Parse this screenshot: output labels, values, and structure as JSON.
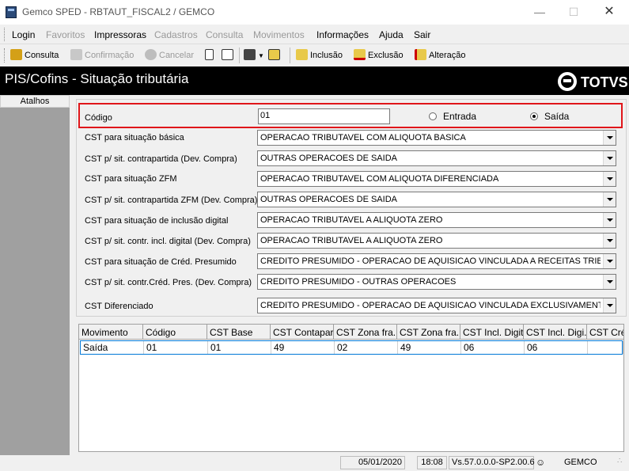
{
  "window": {
    "title": "Gemco SPED - RBTAUT_FISCAL2 / GEMCO",
    "minimize_icon": "minimize-icon",
    "maximize_icon": "maximize-icon",
    "close_icon": "close-icon"
  },
  "menu": {
    "items": [
      {
        "label": "Login",
        "enabled": true
      },
      {
        "label": "Favoritos",
        "enabled": false
      },
      {
        "label": "Impressoras",
        "enabled": true
      },
      {
        "label": "Cadastros",
        "enabled": false
      },
      {
        "label": "Consulta",
        "enabled": false
      },
      {
        "label": "Movimentos",
        "enabled": false
      },
      {
        "label": "Informações",
        "enabled": true
      },
      {
        "label": "Ajuda",
        "enabled": true
      },
      {
        "label": "Sair",
        "enabled": true
      }
    ]
  },
  "toolbar": {
    "consulta": "Consulta",
    "confirmacao": "Confirmação",
    "cancelar": "Cancelar",
    "inclusao": "Inclusão",
    "exclusao": "Exclusão",
    "alteracao": "Alteração"
  },
  "header": {
    "title": "PIS/Cofins - Situação tributária",
    "brand": "TOTVS"
  },
  "sidebar": {
    "title": "Atalhos"
  },
  "form": {
    "codigo_label": "Código",
    "codigo_value": "01",
    "radio_entrada": "Entrada",
    "radio_saida": "Saída",
    "selected_radio": "Saída",
    "fields": [
      {
        "label": "CST para situação básica",
        "value": "OPERACAO TRIBUTAVEL COM ALIQUOTA BASICA"
      },
      {
        "label": "CST p/ sit. contrapartida (Dev. Compra)",
        "value": "OUTRAS OPERACOES DE SAIDA"
      },
      {
        "label": "CST para situação ZFM",
        "value": "OPERACAO TRIBUTAVEL COM ALIQUOTA DIFERENCIADA"
      },
      {
        "label": "CST p/ sit. contrapartida ZFM (Dev. Compra)",
        "value": "OUTRAS OPERACOES DE SAIDA"
      },
      {
        "label": "CST para situação de inclusão digital",
        "value": "OPERACAO TRIBUTAVEL A ALIQUOTA ZERO"
      },
      {
        "label": "CST p/ sit. contr. incl. digital (Dev. Compra)",
        "value": "OPERACAO TRIBUTAVEL A ALIQUOTA ZERO"
      },
      {
        "label": "CST para situação de Créd. Presumido",
        "value": "CREDITO PRESUMIDO - OPERACAO DE AQUISICAO VINCULADA A RECEITAS TRIBUT"
      },
      {
        "label": "CST p/ sit. contr.Créd. Pres. (Dev. Compra)",
        "value": "CREDITO PRESUMIDO - OUTRAS OPERACOES"
      },
      {
        "label": "CST Diferenciado",
        "value": "CREDITO PRESUMIDO - OPERACAO DE AQUISICAO VINCULADA EXCLUSIVAMENTE A"
      }
    ]
  },
  "grid": {
    "columns": [
      "Movimento",
      "Código",
      "CST Base",
      "CST Contapar...",
      "CST Zona fra...",
      "CST Zona fra...",
      "CST Incl. Digital",
      "CST Incl. Digi...",
      "CST Créd"
    ],
    "rows": [
      [
        "Saída",
        "01",
        "01",
        "49",
        "02",
        "49",
        "06",
        "06",
        ""
      ]
    ]
  },
  "status": {
    "date": "05/01/2020",
    "time": "18:08",
    "version": "Vs.57.0.0.0-SP2.00.6",
    "user": "GEMCO"
  },
  "colors": {
    "highlight_border": "#e0161a",
    "header_bg": "#000000",
    "sidebar_bg": "#a0a0a0",
    "selected_row_border": "#0078d7"
  }
}
